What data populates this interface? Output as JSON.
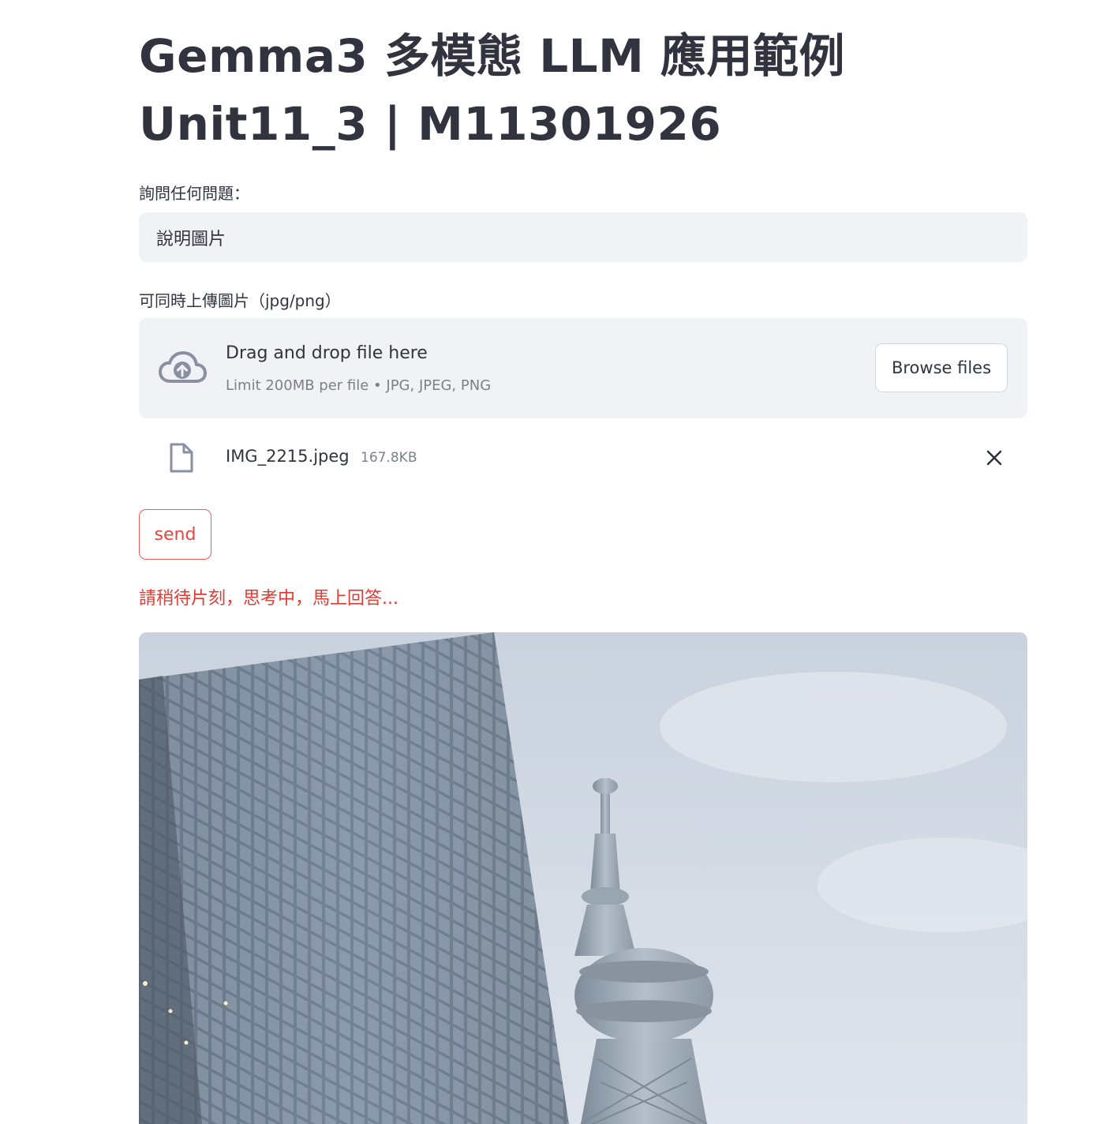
{
  "header": {
    "title": "Gemma3 多模態 LLM 應用範例\nUnit11_3 | M11301926"
  },
  "question": {
    "label": "詢問任何問題：",
    "value": "說明圖片"
  },
  "uploader": {
    "label": "可同時上傳圖片（jpg/png）",
    "drop_title": "Drag and drop file here",
    "drop_subtitle": "Limit 200MB per file • JPG, JPEG, PNG",
    "browse_label": "Browse files",
    "icon": "cloud-upload-icon"
  },
  "uploaded_file": {
    "name": "IMG_2215.jpeg",
    "size": "167.8KB",
    "icon": "file-icon"
  },
  "actions": {
    "send_label": "send"
  },
  "status": {
    "text": "請稍待片刻，思考中，馬上回答..."
  },
  "colors": {
    "accent": "#e03a32",
    "input_bg": "#f0f2f6",
    "text": "#31333f",
    "muted": "#7d7f89"
  }
}
